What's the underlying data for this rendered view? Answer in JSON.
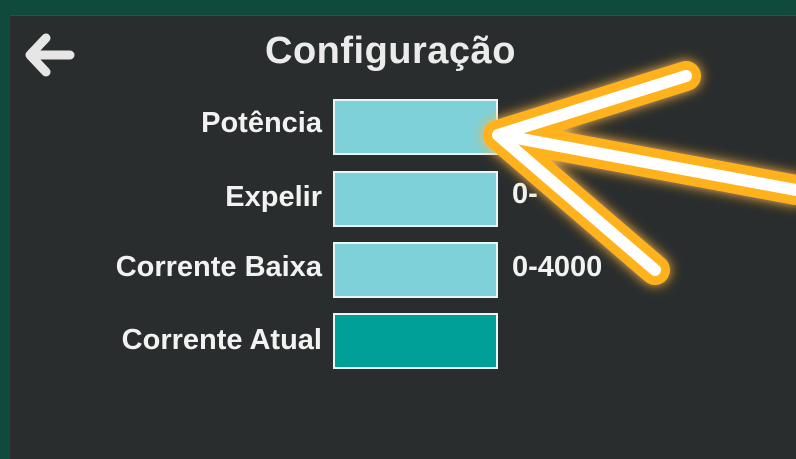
{
  "screen": {
    "title": "Configuração"
  },
  "back": {
    "icon": "arrow-left-icon"
  },
  "fields": [
    {
      "label": "Potência",
      "hint": "",
      "value": ""
    },
    {
      "label": "Expelir",
      "hint": "0-",
      "value": ""
    },
    {
      "label": "Corrente Baixa",
      "hint": "0-4000",
      "value": ""
    },
    {
      "label": "Corrente Atual",
      "hint": "",
      "value": ""
    }
  ],
  "colors": {
    "frame": "#0f4a3c",
    "background": "#2a2d2e",
    "input": "#7fd1d9",
    "input_active": "#00a096",
    "annotation_arrow": "#ffb21a"
  },
  "annotation": {
    "icon": "highlight-arrow-icon"
  }
}
